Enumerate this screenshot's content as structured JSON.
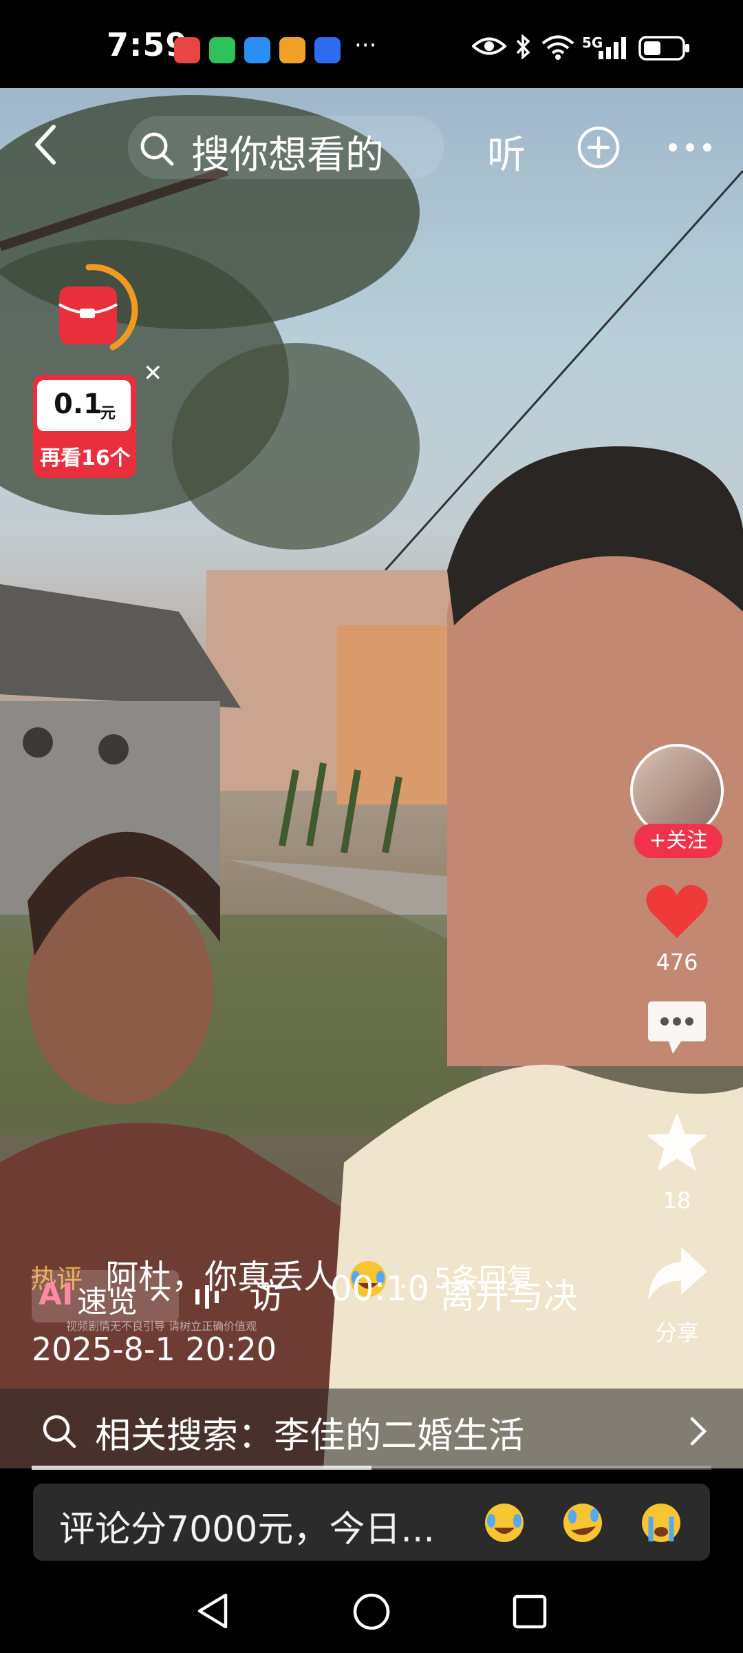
{
  "status_bar": {
    "time": "7:59",
    "app_icons": [
      "red-app-icon",
      "wechat-icon",
      "search-app-icon",
      "video-app-icon",
      "bulb-app-icon"
    ],
    "more": "···",
    "network": "5G"
  },
  "top_nav": {
    "search_placeholder": "搜你想看的",
    "listen_label": "听"
  },
  "red_packet": {
    "amount": "0.1",
    "unit": "元",
    "task": "再看16个"
  },
  "side_rail": {
    "follow_label": "+关注",
    "likes": "476",
    "favorites": "18",
    "share_label": "分享"
  },
  "comment": {
    "tag": "热评",
    "text": "阿杜，你真丢人",
    "replies": "... 5条回复"
  },
  "ai_row": {
    "ai_badge": "AI",
    "ai_label": "速览",
    "title_fragment": "访",
    "timestamp": "00:10",
    "caption": "离开与决",
    "watermark": "视频剧情无不良引导 请树立正确价值观"
  },
  "post_date": "2025-8-1 20:20",
  "related_search": {
    "text": "相关搜索：李佳的二婚生活"
  },
  "comment_bar": {
    "text": "评论分7000元，今日..."
  },
  "colors": {
    "accent_red": "#f03a3a",
    "tag_orange": "#e9a23b",
    "follow_red": "#f0324a"
  }
}
